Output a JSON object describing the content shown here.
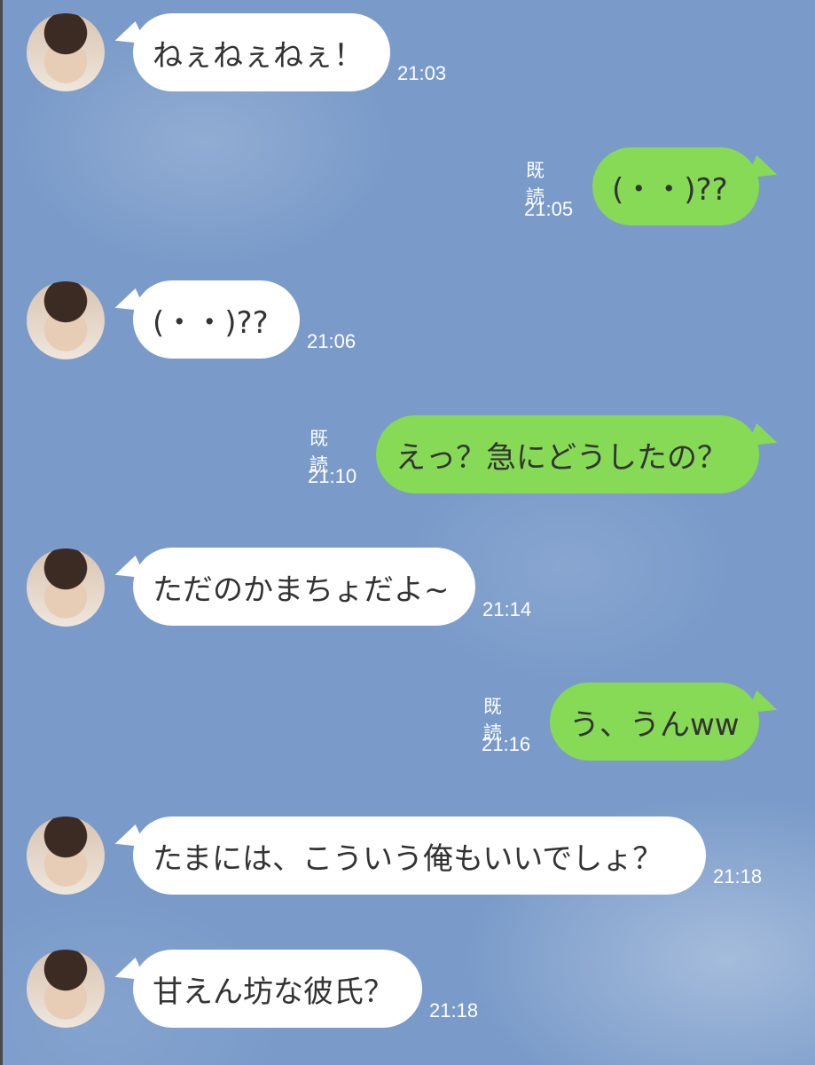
{
  "messages": [
    {
      "side": "in",
      "text": "ねぇねぇねぇ！",
      "time": "21:03"
    },
    {
      "side": "out",
      "text": "(・・)??",
      "time": "21:05",
      "read": "既読"
    },
    {
      "side": "in",
      "text": "(・・)??",
      "time": "21:06"
    },
    {
      "side": "out",
      "text": "えっ？急にどうしたの？",
      "time": "21:10",
      "read": "既読"
    },
    {
      "side": "in",
      "text": "ただのかまちょだよ~",
      "time": "21:14"
    },
    {
      "side": "out",
      "text": "う、うんww",
      "time": "21:16",
      "read": "既読"
    },
    {
      "side": "in",
      "text": "たまには、こういう俺もいいでしょ？",
      "time": "21:18"
    },
    {
      "side": "in",
      "text": "甘えん坊な彼氏？",
      "time": "21:18"
    }
  ],
  "colors": {
    "background": "#7a9bc9",
    "incoming_bubble": "#ffffff",
    "outgoing_bubble": "#86da56",
    "text": "#333333"
  }
}
